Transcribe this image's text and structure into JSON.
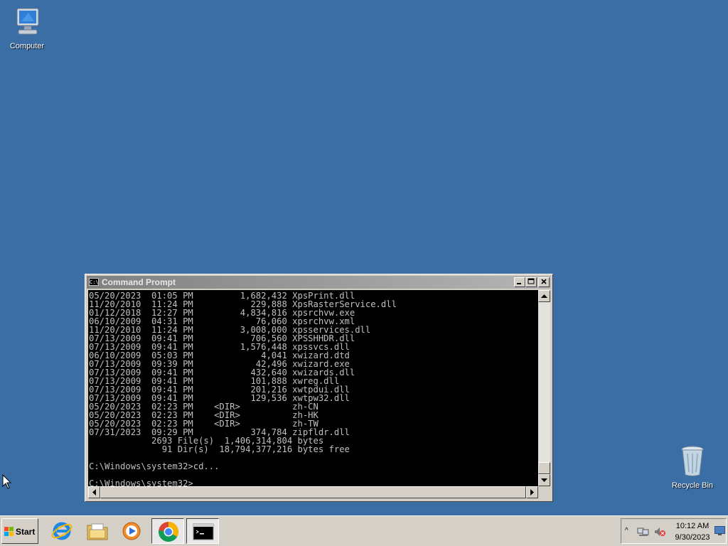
{
  "desktop": {
    "icons": [
      {
        "label": "Computer",
        "icon": "computer-icon"
      },
      {
        "label": "Recycle Bin",
        "icon": "recycle-bin-icon"
      }
    ],
    "background_color": "#3a6ea5"
  },
  "cmd_window": {
    "title": "Command Prompt",
    "title_icon_text": "C:\\",
    "console_lines": [
      "05/20/2023  01:05 PM         1,682,432 XpsPrint.dll",
      "11/20/2010  11:24 PM           229,888 XpsRasterService.dll",
      "01/12/2018  12:27 PM         4,834,816 xpsrchvw.exe",
      "06/10/2009  04:31 PM            76,060 xpsrchvw.xml",
      "11/20/2010  11:24 PM         3,008,000 xpsservices.dll",
      "07/13/2009  09:41 PM           706,560 XPSSHHDR.dll",
      "07/13/2009  09:41 PM         1,576,448 xpssvcs.dll",
      "06/10/2009  05:03 PM             4,041 xwizard.dtd",
      "07/13/2009  09:39 PM            42,496 xwizard.exe",
      "07/13/2009  09:41 PM           432,640 xwizards.dll",
      "07/13/2009  09:41 PM           101,888 xwreg.dll",
      "07/13/2009  09:41 PM           201,216 xwtpdui.dll",
      "07/13/2009  09:41 PM           129,536 xwtpw32.dll",
      "05/20/2023  02:23 PM    <DIR>          zh-CN",
      "05/20/2023  02:23 PM    <DIR>          zh-HK",
      "05/20/2023  02:23 PM    <DIR>          zh-TW",
      "07/31/2023  09:29 PM           374,784 zipfldr.dll",
      "            2693 File(s)  1,406,314,804 bytes",
      "              91 Dir(s)  18,794,377,216 bytes free",
      "",
      "C:\\Windows\\system32>cd...",
      "",
      "C:\\Windows\\system32>"
    ]
  },
  "taskbar": {
    "start_label": "Start",
    "pinned": [
      {
        "name": "internet-explorer",
        "icon": "ie-icon"
      },
      {
        "name": "windows-explorer",
        "icon": "folder-icon"
      },
      {
        "name": "media-player",
        "icon": "media-player-icon"
      },
      {
        "name": "chrome",
        "icon": "chrome-icon"
      },
      {
        "name": "command-prompt",
        "icon": "cmd-icon",
        "active": true
      }
    ],
    "tray": {
      "chevron": "^",
      "clock_time": "10:12 AM",
      "clock_date": "9/30/2023"
    }
  }
}
